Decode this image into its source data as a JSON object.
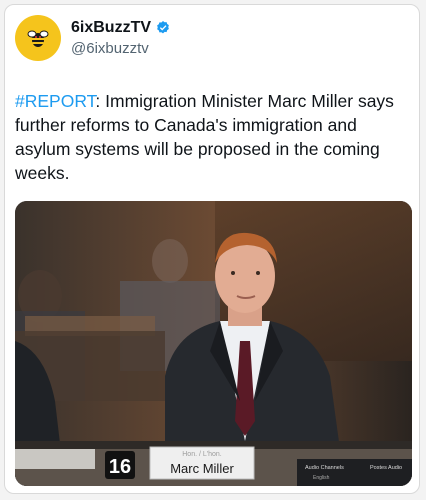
{
  "tweet": {
    "display_name": "6ixBuzzTV",
    "handle": "@6ixbuzztv",
    "verified": true,
    "avatar_icon": "bee-logo-icon",
    "hashtag": "#REPORT",
    "text": ": Immigration Minister Marc Miller says further reforms to Canada's immigration and asylum systems will be proposed in the coming weeks."
  },
  "photo": {
    "desk_number": "16",
    "nameplate_small": "Hon. / L'hon.",
    "nameplate_name": "Marc Miller",
    "channel_label_left": "Audio Channels",
    "channel_label_right": "Postes Audio",
    "channel_label_sub": "English"
  },
  "colors": {
    "accent": "#1d9bf0",
    "avatar_bg": "#f5c41c",
    "text": "#0f1419",
    "muted": "#536471"
  }
}
